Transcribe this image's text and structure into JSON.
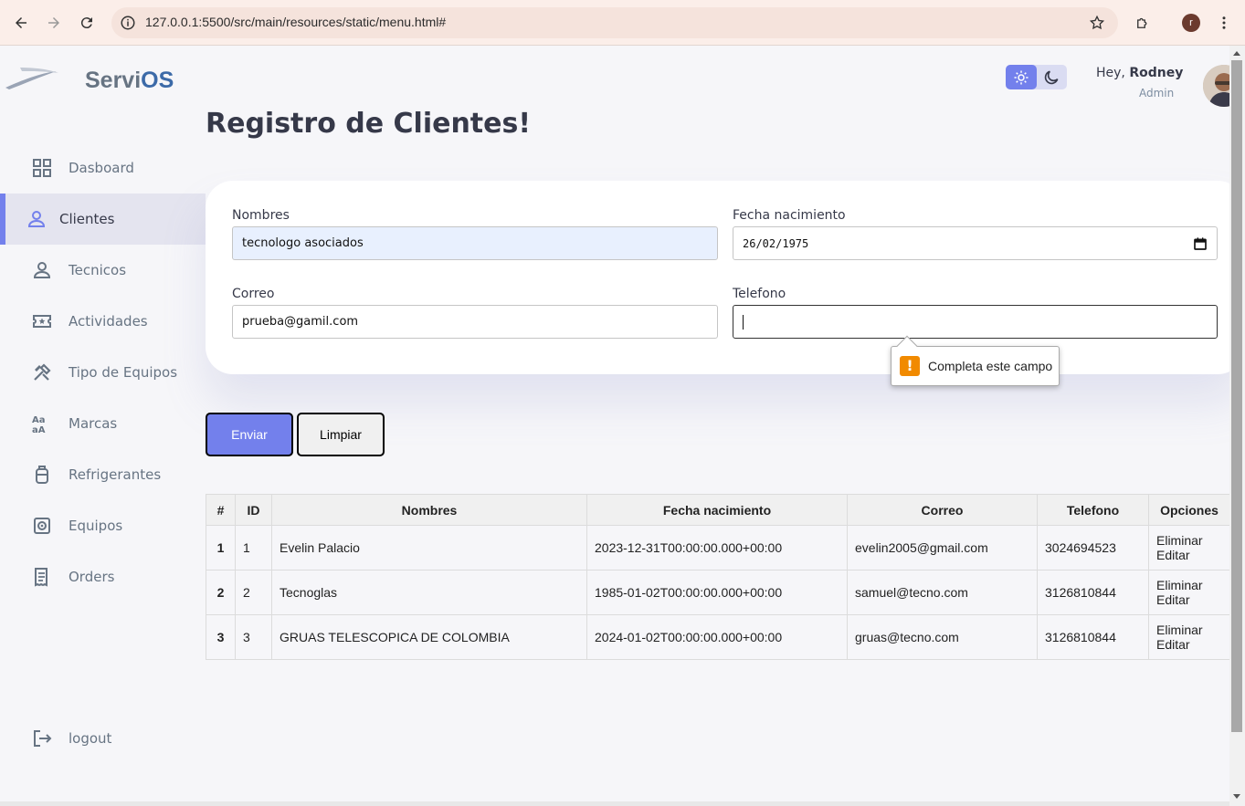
{
  "browser": {
    "url": "127.0.0.1:5500/src/main/resources/static/menu.html#",
    "profile_initial": "r"
  },
  "brand": {
    "name_a": "Servi",
    "name_b": "OS"
  },
  "sidebar": {
    "items": [
      {
        "label": "Dasboard",
        "icon": "grid-icon"
      },
      {
        "label": "Clientes",
        "icon": "person-icon",
        "active": true
      },
      {
        "label": "Tecnicos",
        "icon": "person-icon"
      },
      {
        "label": "Actividades",
        "icon": "ticket-star-icon"
      },
      {
        "label": "Tipo de Equipos",
        "icon": "tools-icon"
      },
      {
        "label": "Marcas",
        "icon": "font-icon"
      },
      {
        "label": "Refrigerantes",
        "icon": "tank-icon"
      },
      {
        "label": "Equipos",
        "icon": "appliance-icon"
      },
      {
        "label": "Orders",
        "icon": "receipt-icon"
      }
    ],
    "logout": "logout"
  },
  "header": {
    "greeting": "Hey, ",
    "user": "Rodney",
    "role": "Admin"
  },
  "page": {
    "title": "Registro de Clientes!"
  },
  "form": {
    "nombres_label": "Nombres",
    "nombres_value": "tecnologo asociados",
    "fecha_label": "Fecha nacimiento",
    "fecha_value": "26/02/1975",
    "correo_label": "Correo",
    "correo_value": "prueba@gamil.com",
    "telefono_label": "Telefono",
    "telefono_value": "",
    "validation_message": "Completa este campo"
  },
  "buttons": {
    "send": "Enviar",
    "clear": "Limpiar"
  },
  "table": {
    "headers": [
      "#",
      "ID",
      "Nombres",
      "Fecha nacimiento",
      "Correo",
      "Telefono",
      "Opciones"
    ],
    "rows": [
      {
        "n": "1",
        "id": "1",
        "nombre": "Evelin Palacio",
        "fecha": "2023-12-31T00:00:00.000+00:00",
        "correo": "evelin2005@gmail.com",
        "telefono": "3024694523",
        "eliminar": "Eliminar",
        "editar": "Editar"
      },
      {
        "n": "2",
        "id": "2",
        "nombre": "Tecnoglas",
        "fecha": "1985-01-02T00:00:00.000+00:00",
        "correo": "samuel@tecno.com",
        "telefono": "3126810844",
        "eliminar": "Eliminar",
        "editar": "Editar"
      },
      {
        "n": "3",
        "id": "3",
        "nombre": "GRUAS TELESCOPICA DE COLOMBIA",
        "fecha": "2024-01-02T00:00:00.000+00:00",
        "correo": "gruas@tecno.com",
        "telefono": "3126810844",
        "eliminar": "Eliminar",
        "editar": "Editar"
      }
    ]
  },
  "colors": {
    "primary": "#7380ec",
    "background": "#f6f6f9",
    "text": "#363949",
    "muted": "#677483"
  }
}
